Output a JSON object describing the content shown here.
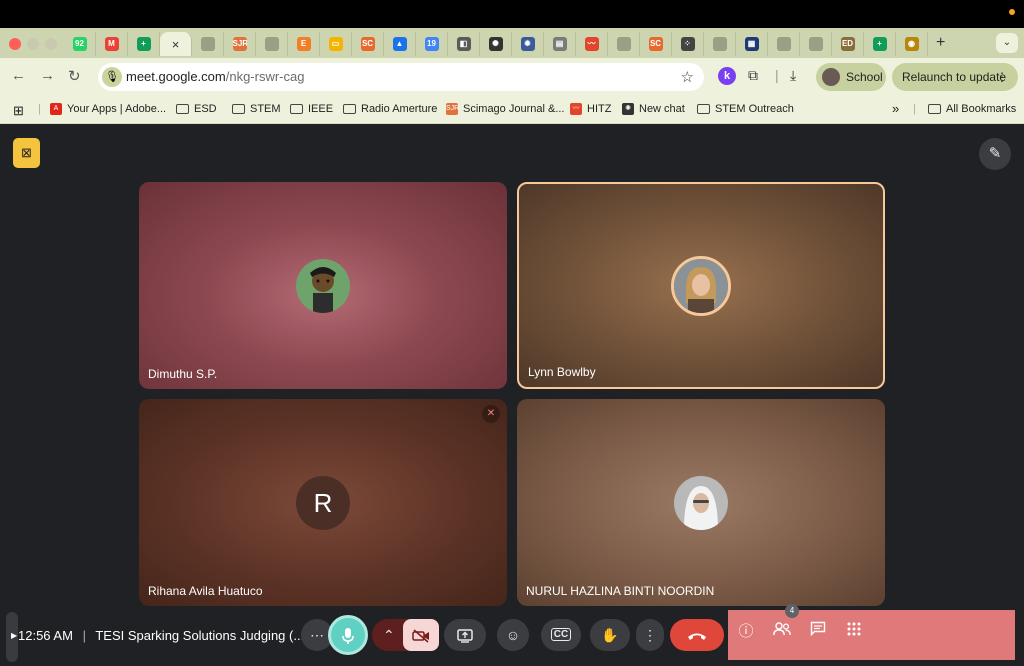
{
  "browser": {
    "tabs": [
      {
        "icon": "whatsapp-icon",
        "color": "#25d366",
        "glyph": "92"
      },
      {
        "icon": "gmail-icon",
        "color": "#ea4335",
        "glyph": "M"
      },
      {
        "icon": "sheets-icon",
        "color": "#0f9d58",
        "glyph": "+"
      },
      {
        "icon": "meet-tab-close-icon",
        "active": true,
        "glyph": "×"
      },
      {
        "icon": "blank-icon",
        "color": "#9aa085",
        "glyph": ""
      },
      {
        "icon": "sjr-icon",
        "color": "#e0733c",
        "glyph": "SJR"
      },
      {
        "icon": "blank-icon",
        "color": "#9aa085",
        "glyph": ""
      },
      {
        "icon": "elsevier-icon",
        "color": "#f07f25",
        "glyph": "E"
      },
      {
        "icon": "slides-icon",
        "color": "#f4b400",
        "glyph": "▭"
      },
      {
        "icon": "sc-icon",
        "color": "#e66a2c",
        "glyph": "SC"
      },
      {
        "icon": "drive-icon",
        "color": "#1a73e8",
        "glyph": "▲"
      },
      {
        "icon": "calendar-icon",
        "color": "#4285f4",
        "glyph": "19"
      },
      {
        "icon": "photo-icon",
        "color": "#5b5b5b",
        "glyph": "◧"
      },
      {
        "icon": "openai-icon",
        "color": "#333333",
        "glyph": "✺"
      },
      {
        "icon": "gear-icon",
        "color": "#3b5a9a",
        "glyph": "✹"
      },
      {
        "icon": "doc-icon",
        "color": "#7a7a7a",
        "glyph": "▤"
      },
      {
        "icon": "hitz-icon",
        "color": "#e3452c",
        "glyph": "〰"
      },
      {
        "icon": "blank-icon",
        "color": "#9aa085",
        "glyph": ""
      },
      {
        "icon": "sc-icon",
        "color": "#e66a2c",
        "glyph": "SC"
      },
      {
        "icon": "dots-icon",
        "color": "#444444",
        "glyph": "⁘"
      },
      {
        "icon": "blank-icon",
        "color": "#9aa085",
        "glyph": ""
      },
      {
        "icon": "ieee-icon",
        "color": "#1f3b73",
        "glyph": "▦"
      },
      {
        "icon": "blank-icon",
        "color": "#9aa085",
        "glyph": ""
      },
      {
        "icon": "blank-icon",
        "color": "#9aa085",
        "glyph": ""
      },
      {
        "icon": "edas-icon",
        "color": "#8a6d3b",
        "glyph": "ED"
      },
      {
        "icon": "sheets-icon",
        "color": "#0f9d58",
        "glyph": "+"
      },
      {
        "icon": "seal-icon",
        "color": "#b8860b",
        "glyph": "◉"
      }
    ],
    "url_host": "meet.google.com",
    "url_path": "/nkg-rswr-cag",
    "profile_label": "School",
    "relaunch_label": "Relaunch to update",
    "bookmarks": [
      {
        "label": "Your Apps | Adobe...",
        "icon": "adobe-icon"
      },
      {
        "label": "ESD",
        "icon": "folder-icon"
      },
      {
        "label": "STEM",
        "icon": "folder-icon"
      },
      {
        "label": "IEEE",
        "icon": "folder-icon"
      },
      {
        "label": "Radio Amerture",
        "icon": "folder-icon"
      },
      {
        "label": "Scimago Journal &...",
        "icon": "sjr-icon"
      },
      {
        "label": "HITZ",
        "icon": "hitz-icon"
      },
      {
        "label": "New chat",
        "icon": "openai-icon"
      },
      {
        "label": "STEM Outreach",
        "icon": "folder-icon"
      }
    ],
    "more_bookmarks": "»",
    "all_bookmarks": "All Bookmarks"
  },
  "meet": {
    "participants": [
      {
        "name": "Dimuthu S.P.",
        "avatar": "photo"
      },
      {
        "name": "Lynn Bowlby",
        "avatar": "photo",
        "speaking": true
      },
      {
        "name": "Rihana Avila Huatuco",
        "avatar_letter": "R",
        "muted": true
      },
      {
        "name": "NURUL HAZLINA BINTI NOORDIN",
        "avatar": "photo"
      }
    ],
    "time": "12:56 AM",
    "separator": "|",
    "meeting_title": "TESI Sparking Solutions Judging (...",
    "people_count": "4",
    "colors": {
      "mic_active": "#5fd0c2",
      "end_call": "#e0473b",
      "speaking_border": "#f6c89a",
      "panel": "#e07a7a"
    }
  }
}
